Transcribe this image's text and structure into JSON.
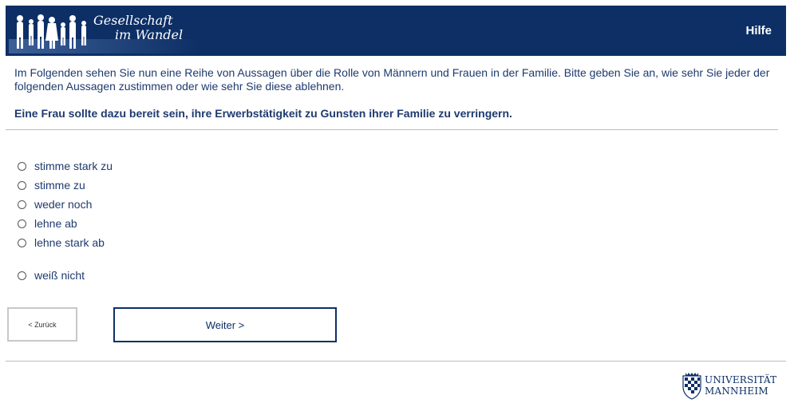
{
  "header": {
    "logo_line1": "Gesellschaft",
    "logo_line2": "im Wandel",
    "help_label": "Hilfe"
  },
  "intro": "Im Folgenden sehen Sie nun eine Reihe von Aussagen über die Rolle von Männern und Frauen in der Familie. Bitte geben Sie an, wie sehr Sie jeder der folgenden Aussagen zustimmen oder wie sehr Sie diese ablehnen.",
  "question": "Eine Frau sollte dazu bereit sein, ihre Erwerbstätigkeit zu Gunsten ihrer Familie zu verringern.",
  "options": [
    {
      "label": "stimme stark zu"
    },
    {
      "label": "stimme zu"
    },
    {
      "label": "weder noch"
    },
    {
      "label": "lehne ab"
    },
    {
      "label": "lehne stark ab"
    },
    {
      "label": "weiß nicht"
    }
  ],
  "nav": {
    "back_label": "< Zurück",
    "next_label": "Weiter >"
  },
  "footer": {
    "uni_line1": "UNIVERSITÄT",
    "uni_line2": "MANNHEIM"
  },
  "colors": {
    "header_bg": "#0d2f66",
    "text": "#1e3a6e"
  }
}
